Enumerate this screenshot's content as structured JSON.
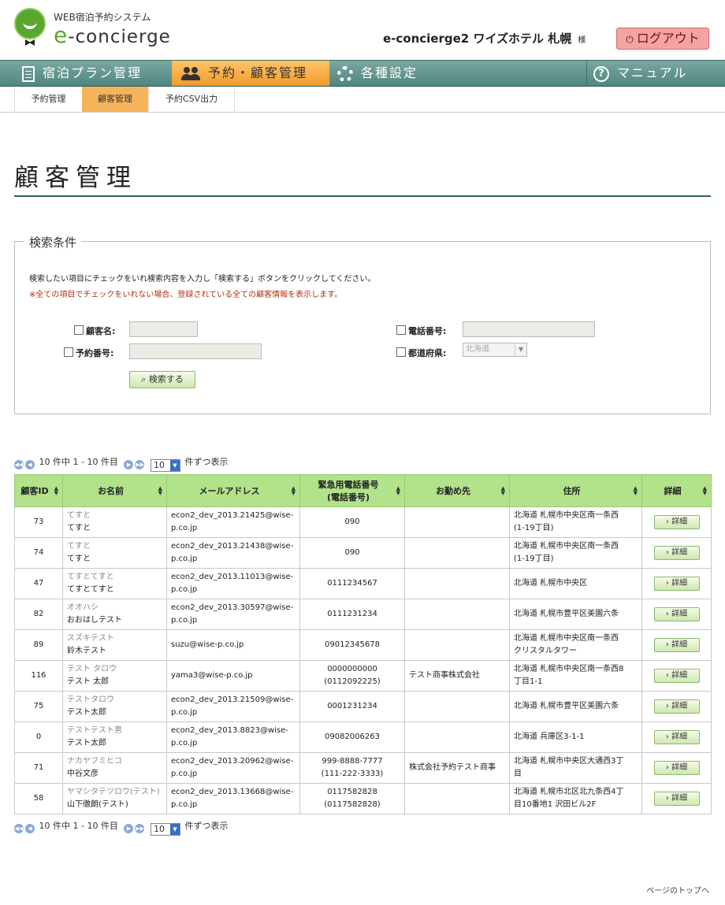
{
  "header": {
    "logo_sub": "WEB宿泊予約システム",
    "logo_main_e": "e",
    "logo_main_rest": "-concierge",
    "hotel_name": "e-concierge2 ワイズホテル 札幌",
    "hotel_suffix": "様",
    "logout_label": "ログアウト"
  },
  "main_nav": {
    "items": [
      {
        "label": "宿泊プラン管理",
        "icon": "document-icon"
      },
      {
        "label": "予約・顧客管理",
        "icon": "people-icon",
        "active": true
      },
      {
        "label": "各種設定",
        "icon": "gear-icon"
      },
      {
        "label": "マニュアル",
        "icon": "help-icon"
      }
    ]
  },
  "sub_nav": {
    "tabs": [
      {
        "label": "予約管理"
      },
      {
        "label": "顧客管理",
        "active": true
      },
      {
        "label": "予約CSV出力"
      }
    ]
  },
  "page_title": "顧客管理",
  "search": {
    "legend": "検索条件",
    "instruction": "検索したい項目にチェックをいれ検索内容を入力し「検索する」ボタンをクリックしてください。",
    "note": "※全ての項目でチェックをいれない場合、登録されている全ての顧客情報を表示します。",
    "customer_name_label": "顧客名:",
    "reservation_no_label": "予約番号:",
    "phone_label": "電話番号:",
    "prefecture_label": "都道府県:",
    "prefecture_value": "北海道",
    "search_button": "検索する"
  },
  "pager": {
    "summary": "10 件中 1 - 10 件目",
    "per_page": "10",
    "per_page_suffix": "件ずつ表示"
  },
  "table": {
    "headers": {
      "id": "顧客ID",
      "name": "お名前",
      "email": "メールアドレス",
      "phone_line1": "緊急用電話番号",
      "phone_line2": "(電話番号)",
      "company": "お勤め先",
      "address": "住所",
      "detail": "詳細"
    },
    "detail_label": "詳細",
    "rows": [
      {
        "id": "73",
        "kana": "てすと",
        "name": "てすと",
        "email_1": "econ2_dev_2013.21425@wise-",
        "email_2": "p.co.jp",
        "phone_1": "090",
        "phone_2": "",
        "company": "",
        "address_1": "北海道 札幌市中央区南一条西",
        "address_2": "(1-19丁目)"
      },
      {
        "id": "74",
        "kana": "てすと",
        "name": "てすと",
        "email_1": "econ2_dev_2013.21438@wise-",
        "email_2": "p.co.jp",
        "phone_1": "090",
        "phone_2": "",
        "company": "",
        "address_1": "北海道 札幌市中央区南一条西",
        "address_2": "(1-19丁目)"
      },
      {
        "id": "47",
        "kana": "てすとてすと",
        "name": "てすとてすと",
        "email_1": "econ2_dev_2013.11013@wise-",
        "email_2": "p.co.jp",
        "phone_1": "0111234567",
        "phone_2": "",
        "company": "",
        "address_1": "北海道 札幌市中央区",
        "address_2": ""
      },
      {
        "id": "82",
        "kana": "オオハシ",
        "name": "おおはしテスト",
        "email_1": "econ2_dev_2013.30597@wise-",
        "email_2": "p.co.jp",
        "phone_1": "0111231234",
        "phone_2": "",
        "company": "",
        "address_1": "北海道 札幌市豊平区美園六条",
        "address_2": ""
      },
      {
        "id": "89",
        "kana": "スズキテスト",
        "name": "鈴木テスト",
        "email_1": "suzu@wise-p.co.jp",
        "email_2": "",
        "phone_1": "09012345678",
        "phone_2": "",
        "company": "",
        "address_1": "北海道 札幌市中央区南一条西",
        "address_2": "クリスタルタワー"
      },
      {
        "id": "116",
        "kana": "テスト タロウ",
        "name": "テスト 太郎",
        "email_1": "yama3@wise-p.co.jp",
        "email_2": "",
        "phone_1": "0000000000",
        "phone_2": "(0112092225)",
        "company": "テスト商事株式会社",
        "address_1": "北海道 札幌市中央区南一条西8",
        "address_2": "丁目1-1"
      },
      {
        "id": "75",
        "kana": "テストタロウ",
        "name": "テスト太郎",
        "email_1": "econ2_dev_2013.21509@wise-",
        "email_2": "p.co.jp",
        "phone_1": "0001231234",
        "phone_2": "",
        "company": "",
        "address_1": "北海道 札幌市豊平区美園六条",
        "address_2": ""
      },
      {
        "id": "0",
        "kana": "テストテスト男",
        "name": "テスト太郎",
        "email_1": "econ2_dev_2013.8823@wise-",
        "email_2": "p.co.jp",
        "phone_1": "09082006263",
        "phone_2": "",
        "company": "",
        "address_1": "北海道 兵庫区3-1-1",
        "address_2": ""
      },
      {
        "id": "71",
        "kana": "ナカヤフミヒコ",
        "name": "中谷文彦",
        "email_1": "econ2_dev_2013.20962@wise-",
        "email_2": "p.co.jp",
        "phone_1": "999-8888-7777",
        "phone_2": "(111-222-3333)",
        "company": "株式会社予約テスト商事",
        "address_1": "北海道 札幌市中央区大通西3丁",
        "address_2": "目"
      },
      {
        "id": "58",
        "kana": "ヤマシタテツロウ(テスト)",
        "name": "山下徹朗(テスト)",
        "email_1": "econ2_dev_2013.13668@wise-",
        "email_2": "p.co.jp",
        "phone_1": "0117582828",
        "phone_2": "(0117582828)",
        "company": "",
        "address_1": "北海道 札幌市北区北九条西4丁",
        "address_2": "目10番地1 沢田ビル2F"
      }
    ]
  },
  "page_top": "ページのトップへ"
}
